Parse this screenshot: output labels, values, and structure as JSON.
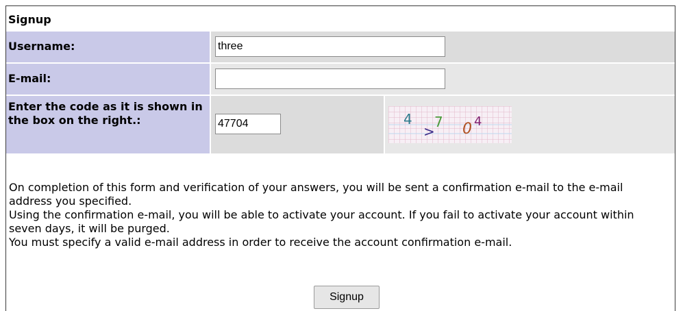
{
  "form": {
    "title": "Signup",
    "username_label": "Username:",
    "username_value": "three",
    "email_label": "E-mail:",
    "email_value": "",
    "code_label": "Enter the code as it is shown in the box on the right.:",
    "code_value": "47704",
    "captcha_chars": [
      "4",
      ">",
      "7",
      "0",
      "4"
    ]
  },
  "info": {
    "line1": "On completion of this form and verification of your answers, you will be sent a confirmation e-mail to the e-mail address you specified.",
    "line2": "Using the confirmation e-mail, you will be able to activate your account. If you fail to activate your account within seven days, it will be purged.",
    "line3": "You must specify a valid e-mail address in order to receive the account confirmation e-mail."
  },
  "submit_label": "Signup",
  "colors": {
    "label_bg": "#c9c9e8",
    "row_bg": "#e7e7e7",
    "row_bg_alt": "#dcdcdc"
  }
}
